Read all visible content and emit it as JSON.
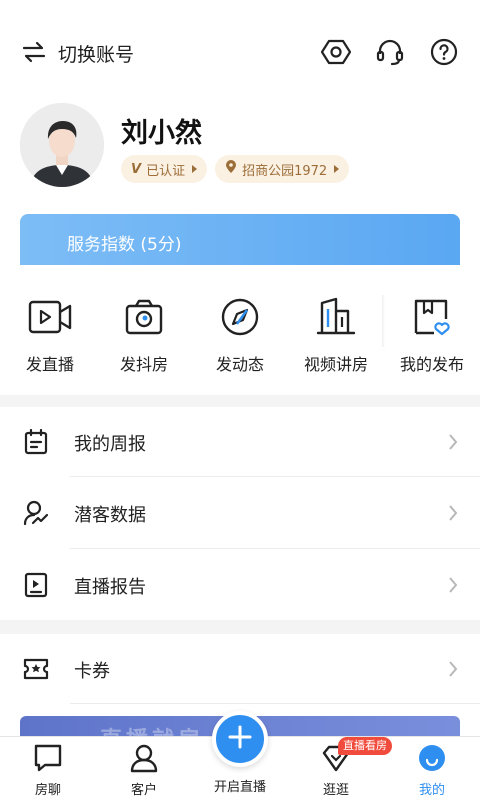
{
  "header": {
    "switch_label": "切换账号",
    "icons": [
      "settings-icon",
      "headset-icon",
      "help-icon"
    ]
  },
  "profile": {
    "name": "刘小然",
    "verified_label": "已认证",
    "store_label": "招商公园1972"
  },
  "service": {
    "label": "服务指数 (5分)"
  },
  "actions": [
    {
      "label": "发直播",
      "icon": "video-camera-icon"
    },
    {
      "label": "发抖房",
      "icon": "camera-icon"
    },
    {
      "label": "发动态",
      "icon": "compass-icon"
    },
    {
      "label": "视频讲房",
      "icon": "building-icon"
    },
    {
      "label": "我的发布",
      "icon": "bookmark-heart-icon"
    }
  ],
  "menu": [
    {
      "label": "我的周报",
      "icon": "calendar-icon"
    },
    {
      "label": "潜客数据",
      "icon": "user-trend-icon"
    },
    {
      "label": "直播报告",
      "icon": "play-report-icon"
    },
    {
      "label": "卡券",
      "icon": "ticket-icon"
    }
  ],
  "banner": {
    "text": "直播就房"
  },
  "tabbar": {
    "tabs": [
      {
        "label": "房聊",
        "icon": "chat-icon"
      },
      {
        "label": "客户",
        "icon": "person-icon"
      },
      {
        "label": "开启直播",
        "icon": "plus-icon"
      },
      {
        "label": "逛逛",
        "icon": "diamond-icon"
      },
      {
        "label": "我的",
        "icon": "smile-icon"
      }
    ],
    "badge": "直播看房",
    "active_color": "#2f8ff0"
  }
}
